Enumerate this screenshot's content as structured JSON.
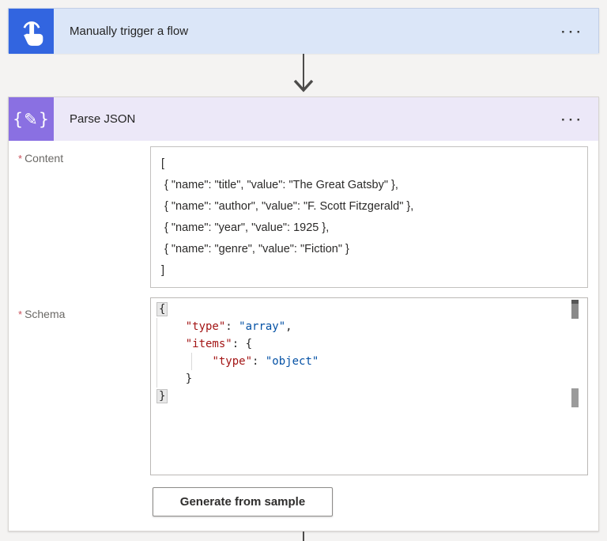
{
  "trigger": {
    "title": "Manually trigger a flow",
    "menu_icon": "···"
  },
  "action": {
    "title": "Parse JSON",
    "menu_icon": "···"
  },
  "fields": {
    "content": {
      "required_mark": "*",
      "label": "Content",
      "lines": [
        "[",
        " { \"name\": \"title\", \"value\": \"The Great Gatsby\" },",
        " { \"name\": \"author\", \"value\": \"F. Scott Fitzgerald\" },",
        " { \"name\": \"year\", \"value\": 1925 },",
        " { \"name\": \"genre\", \"value\": \"Fiction\" }",
        "]"
      ]
    },
    "schema": {
      "required_mark": "*",
      "label": "Schema",
      "code_lines": [
        {
          "tokens": [
            {
              "t": "{",
              "c": "p",
              "hl": true
            }
          ]
        },
        {
          "tokens": [
            {
              "t": "    ",
              "c": "p"
            },
            {
              "t": "\"type\"",
              "c": "k"
            },
            {
              "t": ": ",
              "c": "p"
            },
            {
              "t": "\"array\"",
              "c": "s"
            },
            {
              "t": ",",
              "c": "p"
            }
          ]
        },
        {
          "tokens": [
            {
              "t": "    ",
              "c": "p"
            },
            {
              "t": "\"items\"",
              "c": "k"
            },
            {
              "t": ": {",
              "c": "p"
            }
          ]
        },
        {
          "tokens": [
            {
              "t": "        ",
              "c": "p"
            },
            {
              "t": "\"type\"",
              "c": "k"
            },
            {
              "t": ": ",
              "c": "p"
            },
            {
              "t": "\"object\"",
              "c": "s"
            }
          ]
        },
        {
          "tokens": [
            {
              "t": "    }",
              "c": "p"
            }
          ]
        },
        {
          "tokens": [
            {
              "t": "}",
              "c": "p",
              "hl": true
            }
          ]
        }
      ]
    }
  },
  "buttons": {
    "generate_from_sample": "Generate from sample"
  },
  "colors": {
    "trigger_tile": "#3265e0",
    "trigger_header": "#dbe6f8",
    "action_tile": "#8a70e2",
    "action_header": "#ece8f8",
    "json_key": "#a31515",
    "json_string": "#0451a5",
    "required_star": "#c9505b"
  }
}
